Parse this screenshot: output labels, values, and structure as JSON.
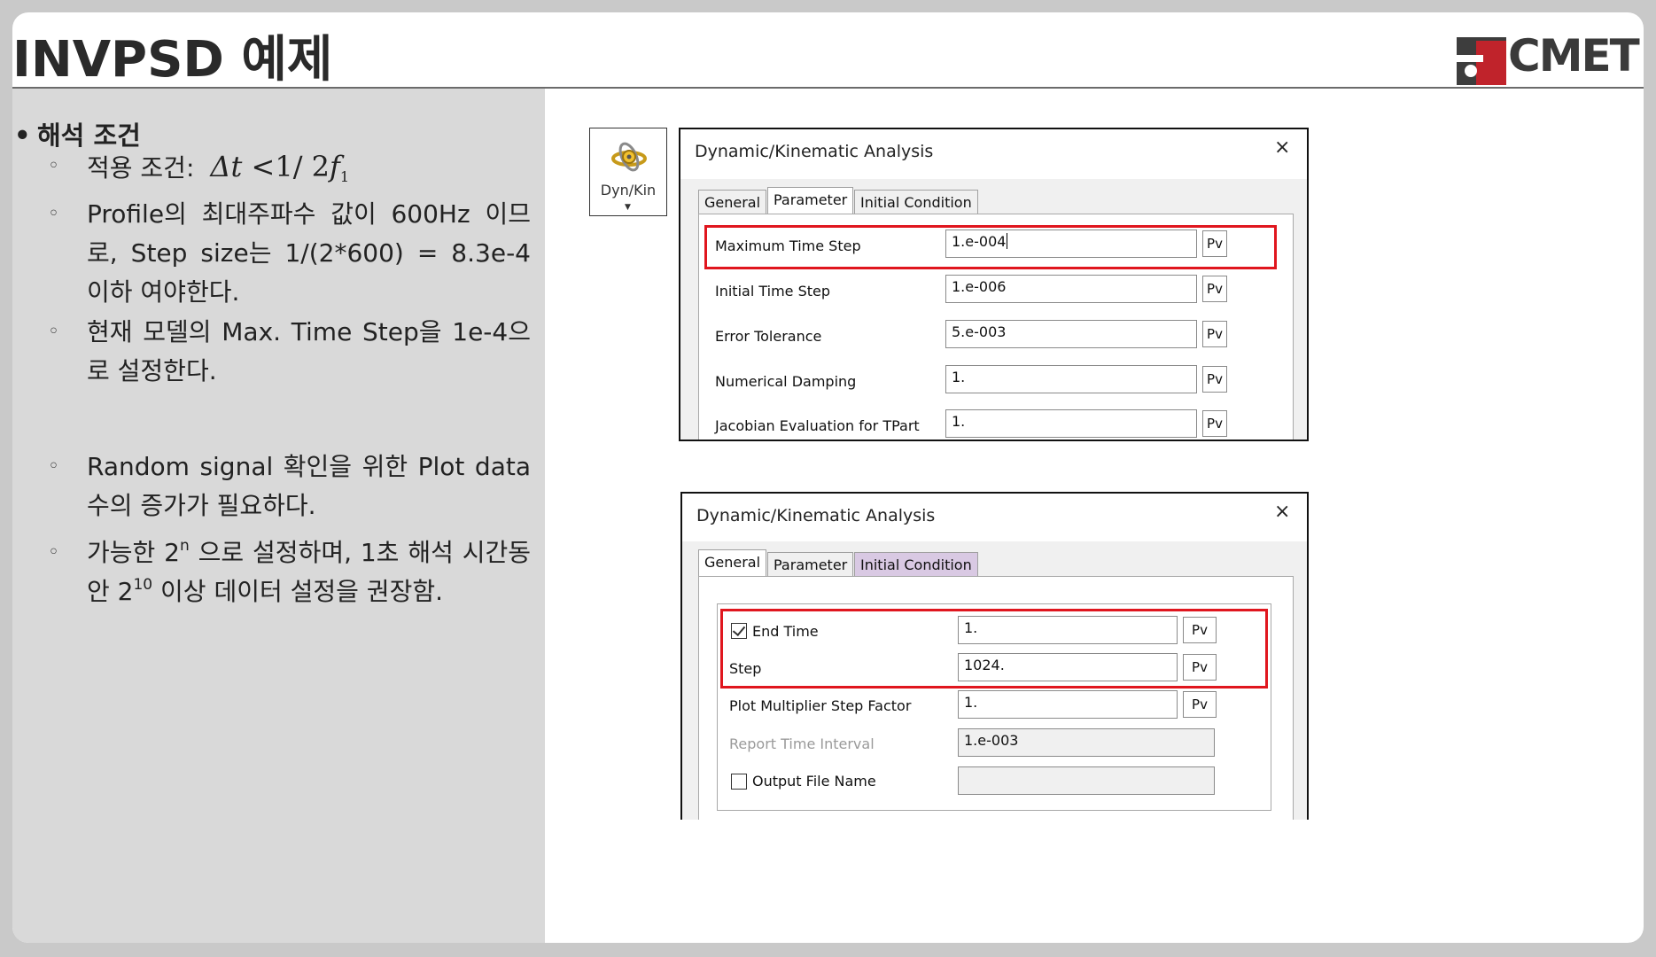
{
  "slide": {
    "title": "INVPSD 예제",
    "logo_text": "CMET"
  },
  "left": {
    "heading": "해석 조건",
    "bullets": [
      {
        "text": "적용 조건:",
        "formula": {
          "lhs": "Δt",
          "op": "<",
          "num": "1",
          "slash": "/",
          "den": "2",
          "var": "f",
          "sub": "1"
        }
      },
      {
        "text": "Profile의 최대주파수 값이 600Hz 이므로, Step size는 1/(2*600) = 8.3e-4 이하 여야한다."
      },
      {
        "text": "현재 모델의 Max. Time Step을 1e-4으로 설정한다."
      },
      {
        "text": "Random signal 확인을 위한 Plot data 수의 증가가 필요하다."
      },
      {
        "text_a": "가능한 2",
        "sup_a": "n",
        "text_b": " 으로 설정하며, 1초 해석 시간동안 2",
        "sup_b": "10",
        "text_c": " 이상 데이터 설정을 권장함."
      }
    ]
  },
  "toolbar": {
    "dynkin_label": "Dyn/Kin",
    "dynkin_caret": "▼"
  },
  "dialog1": {
    "title": "Dynamic/Kinematic Analysis",
    "close": "×",
    "tabs": [
      "General",
      "Parameter",
      "Initial Condition"
    ],
    "active_tab": "Parameter",
    "fields": [
      {
        "label": "Maximum Time Step",
        "value": "1.e-004",
        "pv": "Pv"
      },
      {
        "label": "Initial Time Step",
        "value": "1.e-006",
        "pv": "Pv"
      },
      {
        "label": "Error Tolerance",
        "value": "5.e-003",
        "pv": "Pv"
      },
      {
        "label": "Numerical Damping",
        "value": "1.",
        "pv": "Pv"
      },
      {
        "label": "Jacobian Evaluation for TPart",
        "value": "1.",
        "pv": "Pv"
      }
    ]
  },
  "dialog2": {
    "title": "Dynamic/Kinematic Analysis",
    "close": "×",
    "tabs": [
      "General",
      "Parameter",
      "Initial Condition"
    ],
    "active_tab": "General",
    "fields": [
      {
        "label": "End Time",
        "value": "1.",
        "pv": "Pv",
        "checked": true
      },
      {
        "label": "Step",
        "value": "1024.",
        "pv": "Pv"
      },
      {
        "label": "Plot Multiplier Step Factor",
        "value": "1.",
        "pv": "Pv"
      },
      {
        "label": "Report Time Interval",
        "value": "1.e-003"
      },
      {
        "label": "Output File Name",
        "value": "",
        "checked": false
      }
    ]
  },
  "colors": {
    "highlight": "#e0161e",
    "tab_highlight": "#d9c9e3",
    "panel": "#d9d9d9",
    "logo_red": "#c0232b"
  }
}
